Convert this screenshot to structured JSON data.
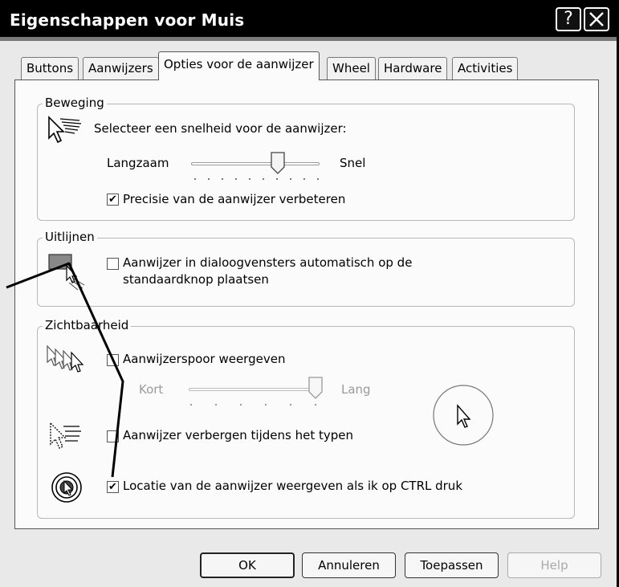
{
  "window": {
    "title": "Eigenschappen voor Muis",
    "help_glyph": "?",
    "close_glyph": "✕"
  },
  "tabs": [
    {
      "label": "Buttons"
    },
    {
      "label": "Aanwijzers"
    },
    {
      "label": "Opties voor de aanwijzer",
      "selected": true
    },
    {
      "label": "Wheel"
    },
    {
      "label": "Hardware"
    },
    {
      "label": "Activities"
    }
  ],
  "motion": {
    "group_label": "Beweging",
    "prompt": "Selecteer een snelheid voor de aanwijzer:",
    "slow_label": "Langzaam",
    "fast_label": "Snel",
    "speed_level_fraction": 0.7,
    "precision_label": "Precisie van de aanwijzer verbeteren",
    "precision_checked": true,
    "icon": "pointer-speed-icon"
  },
  "snap": {
    "group_label": "Uitlijnen",
    "label_line1": "Aanwijzer in dialoogvensters automatisch op de",
    "label_line2": "standaardknop plaatsen",
    "checked": false,
    "icon": "snap-to-button-icon"
  },
  "visibility": {
    "group_label": "Zichtbaarheid",
    "trails_label": "Aanwijzerspoor weergeven",
    "trails_checked": false,
    "short_label": "Kort",
    "long_label": "Lang",
    "trail_length_fraction": 1.0,
    "hide_label": "Aanwijzer verbergen tijdens het typen",
    "hide_checked": false,
    "ctrl_label": "Locatie van de aanwijzer weergeven als ik op CTRL druk",
    "ctrl_checked": true,
    "trails_icon": "pointer-trails-icon",
    "hide_icon": "hide-pointer-icon",
    "ctrl_icon": "locate-pointer-icon",
    "preview_icon": "cursor-preview-icon"
  },
  "buttons": {
    "ok": "OK",
    "cancel": "Annuleren",
    "apply": "Toepassen",
    "help": "Help"
  },
  "colors": {
    "titlebar": "#000000",
    "window_bg": "#e9e9e9",
    "panel_bg": "#fbfbfb",
    "disabled_text": "#9a9a9a"
  }
}
